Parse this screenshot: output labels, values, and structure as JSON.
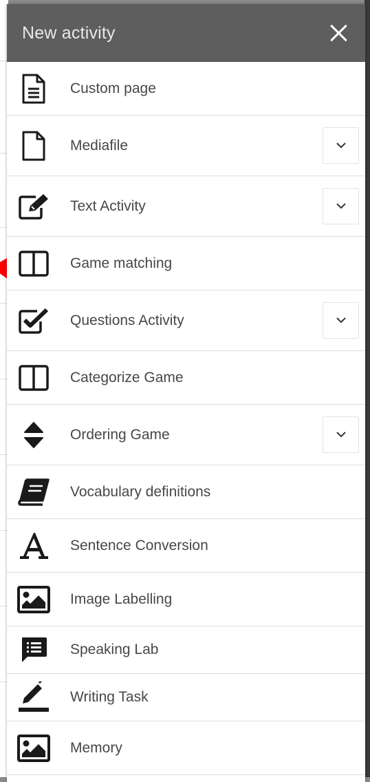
{
  "header": {
    "title": "New activity"
  },
  "items": [
    {
      "label": "Custom page",
      "icon": "document-text-icon",
      "expandable": false
    },
    {
      "label": "Mediafile",
      "icon": "file-icon",
      "expandable": true
    },
    {
      "label": "Text Activity",
      "icon": "edit-icon",
      "expandable": true
    },
    {
      "label": "Game matching",
      "icon": "columns-icon",
      "expandable": false
    },
    {
      "label": "Questions Activity",
      "icon": "checkbox-icon",
      "expandable": true
    },
    {
      "label": "Categorize Game",
      "icon": "columns-icon",
      "expandable": false
    },
    {
      "label": "Ordering Game",
      "icon": "sort-icon",
      "expandable": true
    },
    {
      "label": "Vocabulary definitions",
      "icon": "book-icon",
      "expandable": false
    },
    {
      "label": "Sentence Conversion",
      "icon": "font-a-icon",
      "expandable": false
    },
    {
      "label": "Image Labelling",
      "icon": "image-icon",
      "expandable": false
    },
    {
      "label": "Speaking Lab",
      "icon": "speech-bubble-list-icon",
      "expandable": false
    },
    {
      "label": "Writing Task",
      "icon": "pen-icon",
      "expandable": false
    },
    {
      "label": "Memory",
      "icon": "image-icon",
      "expandable": false
    }
  ],
  "colors": {
    "header_bg": "#5e5e5e",
    "header_text": "#e8e8e8",
    "label_text": "#474747",
    "icon": "#1a1a1a",
    "marker": "#ff0000"
  }
}
